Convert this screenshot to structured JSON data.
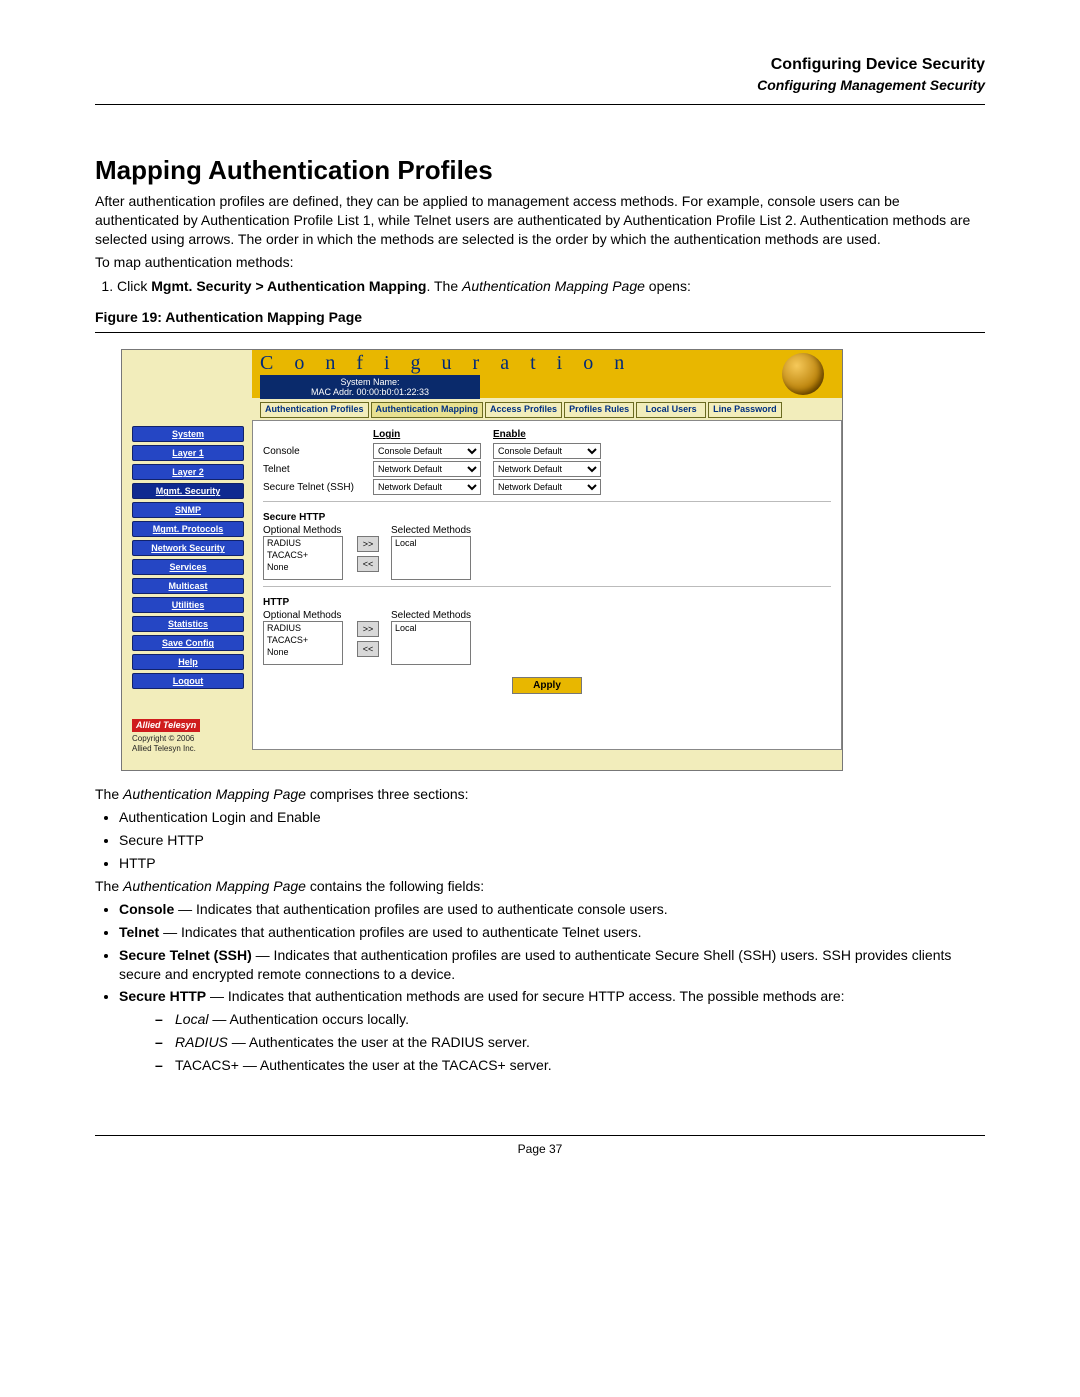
{
  "header": {
    "chapter": "Configuring Device Security",
    "section": "Configuring Management Security"
  },
  "heading": "Mapping Authentication Profiles",
  "intro": "After authentication profiles are defined, they can be applied to management access methods. For example, console users can be authenticated by Authentication Profile List 1, while Telnet users are authenticated by Authentication Profile List 2. Authentication methods are selected using arrows. The order in which the methods are selected is the order by which the authentication methods are used.",
  "lead": "To map authentication methods:",
  "step1_pre": "Click ",
  "step1_bold": "Mgmt. Security > Authentication Mapping",
  "step1_mid": ". The ",
  "step1_italic": "Authentication Mapping Page",
  "step1_post": " opens:",
  "figure_caption": "Figure 19:  Authentication Mapping Page",
  "shot": {
    "title": "C o n f i g u r a t i o n",
    "sys_line1": "System Name:",
    "sys_line2": "MAC Addr. 00:00:b0:01:22:33",
    "tabs": [
      "Authentication Profiles",
      "Authentication Mapping",
      "Access Profiles",
      "Profiles Rules",
      "Local Users",
      "Line Password"
    ],
    "sidebar": [
      "System",
      "Layer 1",
      "Layer 2",
      "Mgmt. Security",
      "SNMP",
      "Mgmt. Protocols",
      "Network Security",
      "Services",
      "Multicast",
      "Utilities",
      "Statistics",
      "Save Config",
      "Help",
      "Logout"
    ],
    "logo_text": "Allied Telesyn",
    "copyright1": "Copyright © 2006",
    "copyright2": "Allied Telesyn Inc.",
    "col_login": "Login",
    "col_enable": "Enable",
    "row1": "Console",
    "row2": "Telnet",
    "row3": "Secure Telnet (SSH)",
    "opt_console": "Console Default",
    "opt_network": "Network Default",
    "sec_https": "Secure HTTP",
    "sec_http": "HTTP",
    "lbl_optional": "Optional Methods",
    "lbl_selected": "Selected Methods",
    "opts_optional": [
      "RADIUS",
      "TACACS+",
      "None"
    ],
    "sel_local": "Local",
    "apply": "Apply",
    "dim": "984×605"
  },
  "comprises_pre": "The ",
  "comprises_it": "Authentication Mapping Page",
  "comprises_post": " comprises three sections:",
  "sections": [
    "Authentication Login and Enable",
    "Secure HTTP",
    "HTTP"
  ],
  "contains_pre": "The ",
  "contains_it": "Authentication Mapping Page",
  "contains_post": " contains the following fields:",
  "fields": {
    "console_b": "Console",
    "console_t": " — Indicates that authentication profiles are used to authenticate console users.",
    "telnet_b": "Telnet",
    "telnet_t": " — Indicates that authentication profiles are used to authenticate Telnet users.",
    "ssh_b": "Secure Telnet (SSH)",
    "ssh_t": " — Indicates that authentication profiles are used to authenticate Secure Shell (SSH) users. SSH provides clients secure and encrypted remote connections to a device.",
    "shttp_b": "Secure HTTP",
    "shttp_t": " — Indicates that authentication methods are used for secure HTTP access. The possible methods are:",
    "sub_local_i": "Local",
    "sub_local_t": " — Authentication occurs locally.",
    "sub_radius_i": "RADIUS",
    "sub_radius_t": " — Authenticates the user at the RADIUS server.",
    "sub_tacacs": "TACACS+ — Authenticates the user at the TACACS+ server."
  },
  "footer": "Page 37"
}
